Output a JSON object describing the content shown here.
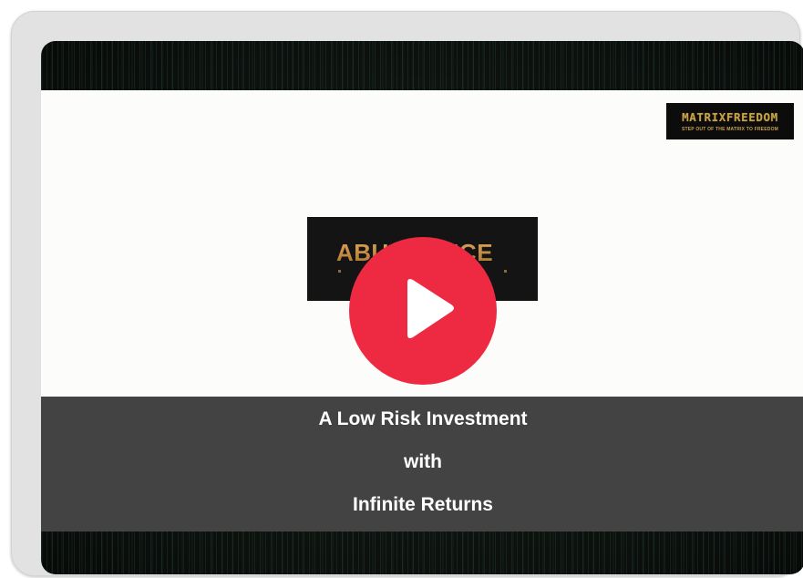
{
  "brand": {
    "name": "MATRIXFREEDOM",
    "tagline": "STEP OUT OF THE MATRIX TO FREEDOM"
  },
  "video": {
    "center_logo_text": "ABUNDANCE",
    "play_icon": "play-icon",
    "accent_color": "#ee2a43"
  },
  "caption": {
    "line1": "A Low Risk Investment",
    "line2": "with",
    "line3": "Infinite Returns"
  }
}
